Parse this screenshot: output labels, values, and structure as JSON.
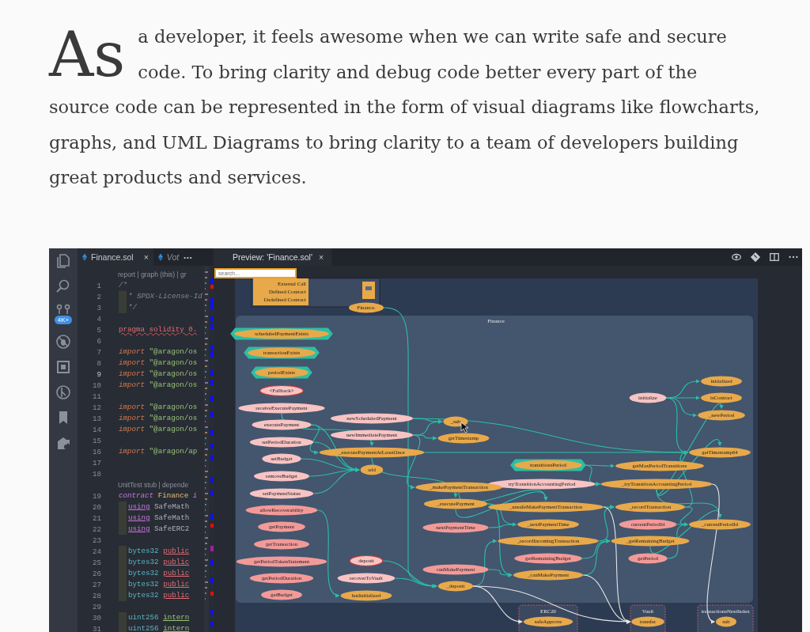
{
  "article": {
    "drop_cap": "As",
    "text": "a developer, it feels awesome when we can write safe and secure code. To bring clarity and debug code better every part of the source code can be represented in the form of visual diagrams like flowcharts, graphs, and UML Diagrams to bring clarity to a team of developers building great products and services."
  },
  "editor": {
    "badge": "4K+",
    "tabs": [
      {
        "label": "Finance.sol",
        "selected": true,
        "close": "×"
      },
      {
        "label": "Vot",
        "selected": false
      }
    ],
    "more": "•••",
    "lines": [
      {
        "kind": "lens",
        "text": "report | graph (this) | gr"
      },
      {
        "kind": "code",
        "number": "1",
        "current": false,
        "indented": false,
        "segments": [
          {
            "text": "/*",
            "kind": "comment"
          }
        ]
      },
      {
        "kind": "code",
        "number": "2",
        "current": false,
        "indented": true,
        "segments": [
          {
            "text": "* SPDX-License-Id",
            "kind": "comment"
          }
        ]
      },
      {
        "kind": "code",
        "number": "3",
        "current": false,
        "indented": true,
        "segments": [
          {
            "text": "*/",
            "kind": "comment"
          }
        ]
      },
      {
        "kind": "code",
        "number": "4",
        "current": false
      },
      {
        "kind": "code",
        "number": "5",
        "current": false,
        "indented": false,
        "segments": [
          {
            "text": "pragma solidity 0.",
            "kind": "error"
          }
        ]
      },
      {
        "kind": "code",
        "number": "6",
        "current": false
      },
      {
        "kind": "code",
        "number": "7",
        "current": false,
        "indented": false,
        "segments": [
          {
            "text": "import",
            "kind": "keyword"
          },
          {
            "text": "\"@aragon/os",
            "kind": "string"
          }
        ]
      },
      {
        "kind": "code",
        "number": "8",
        "current": false,
        "indented": false,
        "segments": [
          {
            "text": "import",
            "kind": "keyword"
          },
          {
            "text": "\"@aragon/os",
            "kind": "string"
          }
        ]
      },
      {
        "kind": "code",
        "number": "9",
        "current": true,
        "indented": false,
        "segments": [
          {
            "text": "import",
            "kind": "keyword"
          },
          {
            "text": "\"@aragon/os",
            "kind": "string"
          }
        ]
      },
      {
        "kind": "code",
        "number": "10",
        "current": false,
        "indented": false,
        "segments": [
          {
            "text": "import",
            "kind": "keyword"
          },
          {
            "text": "\"@aragon/os",
            "kind": "string"
          }
        ]
      },
      {
        "kind": "code",
        "number": "11",
        "current": false
      },
      {
        "kind": "code",
        "number": "12",
        "current": false,
        "indented": false,
        "segments": [
          {
            "text": "import",
            "kind": "keyword"
          },
          {
            "text": "\"@aragon/os",
            "kind": "string"
          }
        ]
      },
      {
        "kind": "code",
        "number": "13",
        "current": false,
        "indented": false,
        "segments": [
          {
            "text": "import",
            "kind": "keyword"
          },
          {
            "text": "\"@aragon/os",
            "kind": "string"
          }
        ]
      },
      {
        "kind": "code",
        "number": "14",
        "current": false,
        "indented": false,
        "segments": [
          {
            "text": "import",
            "kind": "keyword"
          },
          {
            "text": "\"@aragon/os",
            "kind": "string"
          }
        ]
      },
      {
        "kind": "code",
        "number": "15",
        "current": false
      },
      {
        "kind": "code",
        "number": "16",
        "current": false,
        "indented": false,
        "segments": [
          {
            "text": "import",
            "kind": "keyword"
          },
          {
            "text": "\"@aragon/ap",
            "kind": "string"
          }
        ]
      },
      {
        "kind": "code",
        "number": "17",
        "current": false
      },
      {
        "kind": "code",
        "number": "18",
        "current": false
      },
      {
        "kind": "lens",
        "text": "UnitTest stub | depende"
      },
      {
        "kind": "code",
        "number": "19",
        "current": false,
        "indented": false,
        "segments": [
          {
            "text": "contract",
            "kind": "declare"
          },
          {
            "text": "Finance",
            "kind": "class"
          },
          {
            "text": "i",
            "kind": "declare"
          }
        ]
      },
      {
        "kind": "code",
        "number": "20",
        "current": false,
        "indented": true,
        "segments": [
          {
            "text": "using",
            "kind": "using"
          },
          {
            "text": "SafeMath",
            "kind": "plain"
          }
        ]
      },
      {
        "kind": "code",
        "number": "21",
        "current": false,
        "indented": true,
        "segments": [
          {
            "text": "using",
            "kind": "using"
          },
          {
            "text": "SafeMath",
            "kind": "plain"
          }
        ]
      },
      {
        "kind": "code",
        "number": "22",
        "current": false,
        "indented": true,
        "segments": [
          {
            "text": "using",
            "kind": "using"
          },
          {
            "text": "SafeERC2",
            "kind": "plain"
          }
        ]
      },
      {
        "kind": "code",
        "number": "23",
        "current": false
      },
      {
        "kind": "code",
        "number": "24",
        "current": false,
        "indented": true,
        "segments": [
          {
            "text": "bytes32",
            "kind": "type"
          },
          {
            "text": "public",
            "kind": "visibility"
          }
        ]
      },
      {
        "kind": "code",
        "number": "25",
        "current": false,
        "indented": true,
        "segments": [
          {
            "text": "bytes32",
            "kind": "type"
          },
          {
            "text": "public",
            "kind": "visibility"
          }
        ]
      },
      {
        "kind": "code",
        "number": "26",
        "current": false,
        "indented": true,
        "segments": [
          {
            "text": "bytes32",
            "kind": "type"
          },
          {
            "text": "public",
            "kind": "visibility"
          }
        ]
      },
      {
        "kind": "code",
        "number": "27",
        "current": false,
        "indented": true,
        "segments": [
          {
            "text": "bytes32",
            "kind": "type"
          },
          {
            "text": "public",
            "kind": "visibility"
          }
        ]
      },
      {
        "kind": "code",
        "number": "28",
        "current": false,
        "indented": true,
        "segments": [
          {
            "text": "bytes32",
            "kind": "type"
          },
          {
            "text": "public",
            "kind": "visibility"
          }
        ]
      },
      {
        "kind": "code",
        "number": "29",
        "current": false
      },
      {
        "kind": "code",
        "number": "30",
        "current": false,
        "indented": true,
        "segments": [
          {
            "text": "uint256",
            "kind": "type"
          },
          {
            "text": "intern",
            "kind": "internal"
          }
        ]
      },
      {
        "kind": "code",
        "number": "31",
        "current": false,
        "indented": true,
        "segments": [
          {
            "text": "uint256",
            "kind": "type"
          },
          {
            "text": "intern",
            "kind": "internal"
          }
        ]
      }
    ]
  },
  "preview": {
    "tab": "Preview: 'Finance.sol'",
    "close": "×",
    "search": {
      "placeholder": "search..."
    },
    "legend": [
      "External Call",
      "Defined Contract",
      "Undefined Contract"
    ],
    "cluster": "Finance",
    "groups": [
      "ERC20",
      "Vault",
      "transactionsNextIndex"
    ],
    "nodes": [
      {
        "label": "Finance.",
        "kind": "internal"
      },
      {
        "label": "scheduledPaymentExists",
        "kind": "modifier"
      },
      {
        "label": "transactionExists",
        "kind": "modifier"
      },
      {
        "label": "periodExists",
        "kind": "modifier"
      },
      {
        "label": "<Fallback>",
        "kind": "payable"
      },
      {
        "label": "receiveExecutePayment",
        "kind": "public"
      },
      {
        "label": "executePayment",
        "kind": "public"
      },
      {
        "label": "setPeriodDuration",
        "kind": "public"
      },
      {
        "label": "setBudget",
        "kind": "public"
      },
      {
        "label": "removeBudget",
        "kind": "public"
      },
      {
        "label": "setPaymentStatus",
        "kind": "public"
      },
      {
        "label": "allowRecoverability",
        "kind": "external"
      },
      {
        "label": "getPayment",
        "kind": "external"
      },
      {
        "label": "getTransaction",
        "kind": "external"
      },
      {
        "label": "getPeriodTokenStatement",
        "kind": "external"
      },
      {
        "label": "getPeriodDuration",
        "kind": "external"
      },
      {
        "label": "getBudget",
        "kind": "external"
      },
      {
        "label": "newScheduledPayment",
        "kind": "public"
      },
      {
        "label": "newImmediatePayment",
        "kind": "public"
      },
      {
        "label": "_executePaymentAtLeastOnce",
        "kind": "internal"
      },
      {
        "label": "add",
        "kind": "internal"
      },
      {
        "label": "_sub",
        "kind": "internal"
      },
      {
        "label": "getTimestamp",
        "kind": "internal"
      },
      {
        "label": "initialize",
        "kind": "public"
      },
      {
        "label": "initialized",
        "kind": "internal"
      },
      {
        "label": "isContract",
        "kind": "internal"
      },
      {
        "label": "_newPeriod",
        "kind": "internal"
      },
      {
        "label": "getTimestamp64",
        "kind": "internal"
      },
      {
        "label": "transitionsPeriod",
        "kind": "modifier"
      },
      {
        "label": "getMaxPeriodTransitions",
        "kind": "internal"
      },
      {
        "label": "tryTransitionAccountingPeriod",
        "kind": "public"
      },
      {
        "label": "_tryTransitionAccountingPeriod",
        "kind": "internal"
      },
      {
        "label": "_makePaymentTransaction",
        "kind": "internal"
      },
      {
        "label": "_executePayment",
        "kind": "internal"
      },
      {
        "label": "_unsafeMakePaymentTransaction",
        "kind": "internal"
      },
      {
        "label": "_recordTransaction",
        "kind": "internal"
      },
      {
        "label": "nextPaymentTime",
        "kind": "external"
      },
      {
        "label": "_nextPaymentTime",
        "kind": "internal"
      },
      {
        "label": "currentPeriodId",
        "kind": "external"
      },
      {
        "label": "_currentPeriodId",
        "kind": "internal"
      },
      {
        "label": "_recordIncomingTransaction",
        "kind": "internal"
      },
      {
        "label": "_getRemainingBudget",
        "kind": "internal"
      },
      {
        "label": "getRemainingBudget",
        "kind": "external"
      },
      {
        "label": "getPeriod",
        "kind": "external"
      },
      {
        "label": "deposit",
        "kind": "payable"
      },
      {
        "label": "recoverToVault",
        "kind": "public"
      },
      {
        "label": "hasInitialized",
        "kind": "internal"
      },
      {
        "label": "canMakePayment",
        "kind": "external"
      },
      {
        "label": "_canMakePayment",
        "kind": "internal"
      },
      {
        "label": "_deposit",
        "kind": "internal"
      },
      {
        "label": "safeApprove",
        "kind": "internal"
      },
      {
        "label": "transfer",
        "kind": "internal"
      },
      {
        "label": "sub",
        "kind": "internal"
      }
    ]
  }
}
